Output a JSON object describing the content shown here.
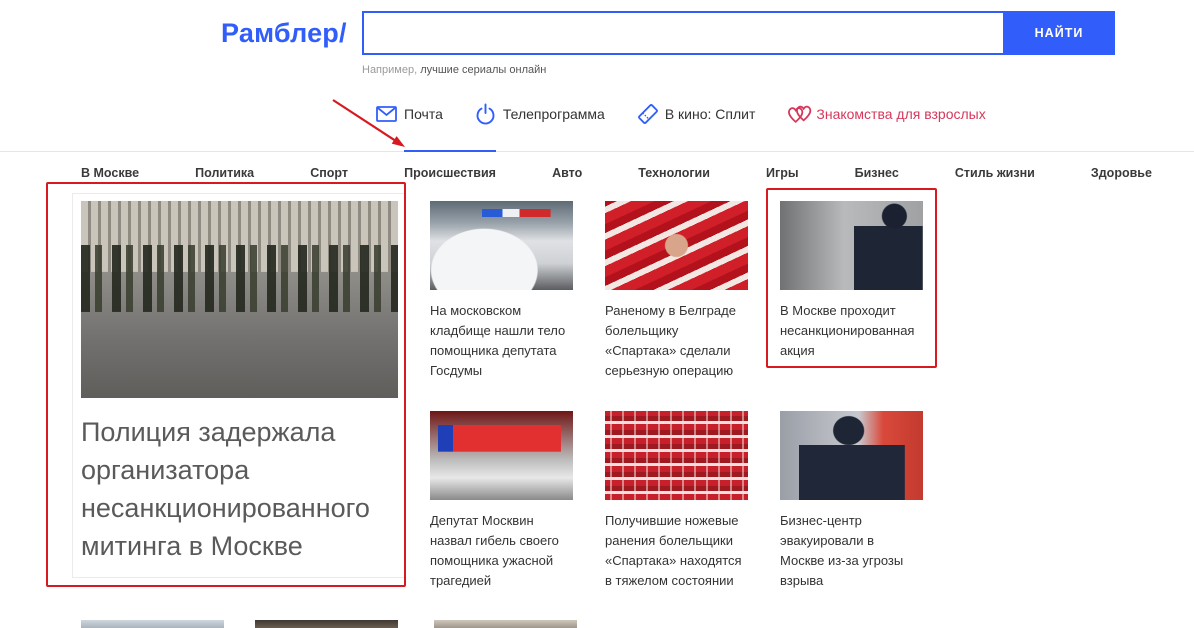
{
  "header": {
    "logo": "Рамблер/",
    "search": {
      "value": "",
      "button_label": "НАЙТИ"
    },
    "hint": {
      "prefix": "Например,",
      "example": "лучшие сериалы онлайн"
    }
  },
  "services": [
    {
      "label": "Почта",
      "icon": "mail-icon"
    },
    {
      "label": "Телепрограмма",
      "icon": "power-icon"
    },
    {
      "label": "В кино: Сплит",
      "icon": "ticket-icon"
    },
    {
      "label": "Знакомства для взрослых",
      "icon": "hearts-icon"
    }
  ],
  "categories": {
    "active": "Происшествия",
    "items": [
      "В Москве",
      "Политика",
      "Спорт",
      "Происшествия",
      "Авто",
      "Технологии",
      "Игры",
      "Бизнес",
      "Стиль жизни",
      "Здоровье"
    ]
  },
  "featured": {
    "headline_lines": [
      "Полиция задержала",
      "организатора",
      "несанкционированного",
      "митинга в Москве"
    ]
  },
  "news": [
    {
      "headline_lines": [
        "На московском",
        "кладбище нашли тело",
        "помощника депутата",
        "Госдумы"
      ]
    },
    {
      "headline_lines": [
        "Раненому в Белграде",
        "болельщику",
        "«Спартака» сделали",
        "серьезную операцию"
      ]
    },
    {
      "headline_lines": [
        "В Москве проходит",
        "несанкционированная",
        "акция"
      ]
    },
    {
      "headline_lines": [
        "Депутат Москвин",
        "назвал гибель своего",
        "помощника ужасной",
        "трагедией"
      ]
    },
    {
      "headline_lines": [
        "Получившие ножевые",
        "ранения болельщики",
        "«Спартака» находятся",
        "в тяжелом состоянии"
      ]
    },
    {
      "headline_lines": [
        "Бизнес-центр",
        "эвакуировали в",
        "Москве из-за угрозы",
        "взрыва"
      ]
    }
  ],
  "colors": {
    "brand": "#315efb",
    "dating_link": "#d6385c",
    "annotation": "#d71920"
  }
}
